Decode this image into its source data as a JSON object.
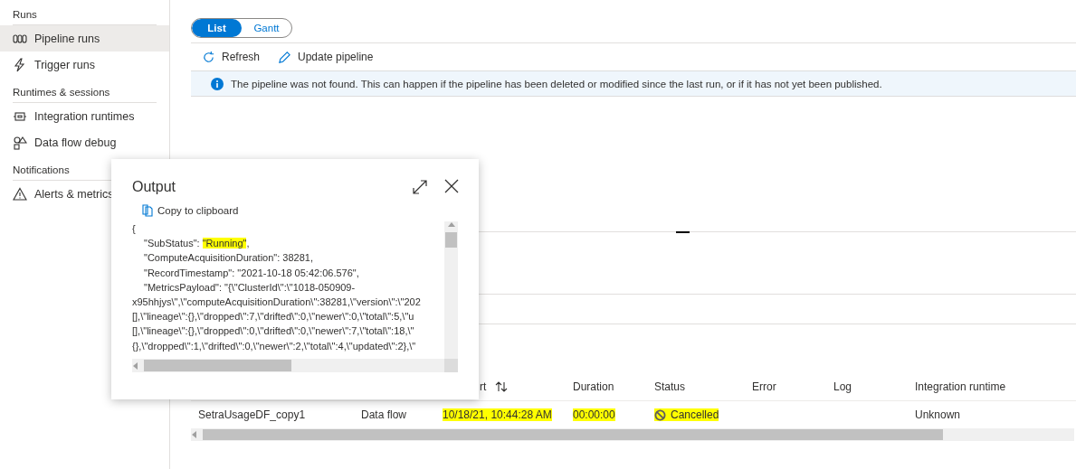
{
  "sidebar": {
    "sections": [
      {
        "heading": "Runs",
        "items": [
          {
            "label": "Pipeline runs",
            "kind": "pipeline",
            "selected": true
          },
          {
            "label": "Trigger runs",
            "kind": "trigger",
            "selected": false
          }
        ]
      },
      {
        "heading": "Runtimes & sessions",
        "items": [
          {
            "label": "Integration runtimes",
            "kind": "runtime",
            "selected": false
          },
          {
            "label": "Data flow debug",
            "kind": "debug",
            "selected": false
          }
        ]
      },
      {
        "heading": "Notifications",
        "items": [
          {
            "label": "Alerts & metrics",
            "kind": "alert",
            "selected": false
          }
        ]
      }
    ]
  },
  "view_toggle": [
    {
      "label": "List",
      "selected": true
    },
    {
      "label": "Gantt",
      "selected": false
    }
  ],
  "toolbar": [
    {
      "label": "Refresh",
      "kind": "refresh"
    },
    {
      "label": "Update pipeline",
      "kind": "edit"
    }
  ],
  "info_banner": "The pipeline was not found. This can happen if the pipeline has been deleted or modified since the last run, or if it has not yet been published.",
  "table": {
    "columns": [
      {
        "label": "rt",
        "sortable": true
      },
      {
        "label": "Duration",
        "sortable": false
      },
      {
        "label": "Status",
        "sortable": false
      },
      {
        "label": "Error",
        "sortable": false
      },
      {
        "label": "Log",
        "sortable": false
      },
      {
        "label": "Integration runtime",
        "sortable": false
      }
    ],
    "rows": [
      {
        "name": {
          "text": "SetraUsageDF_copy1",
          "highlighted": false
        },
        "type": {
          "text": "Data flow",
          "highlighted": false
        },
        "run_start": {
          "text": "10/18/21, 10:44:28 AM",
          "highlighted": true
        },
        "duration": {
          "text": "00:00:00",
          "highlighted": true
        },
        "status": {
          "text": "Cancelled",
          "highlighted": true
        },
        "integration_runtime": {
          "text": "Unknown",
          "highlighted": false
        }
      }
    ]
  },
  "output_dialog": {
    "title": "Output",
    "copy_label": "Copy to clipboard",
    "lines": [
      {
        "indent": false,
        "text": "{"
      },
      {
        "indent": true,
        "text": "\"SubStatus\": ",
        "highlight": "\"Running\"",
        "rest": ","
      },
      {
        "indent": true,
        "text": "\"ComputeAcquisitionDuration\": 38281,"
      },
      {
        "indent": true,
        "text": "\"RecordTimestamp\": \"2021-10-18 05:42:06.576\","
      },
      {
        "indent": true,
        "text": "\"MetricsPayload\": \"{\\\"ClusterId\\\":\\\"1018-050909-"
      },
      {
        "indent": false,
        "text": "x95hhjys\\\",\\\"computeAcquisitionDuration\\\":38281,\\\"version\\\":\\\"202"
      },
      {
        "indent": false,
        "text": "[],\\\"lineage\\\":{},\\\"dropped\\\":7,\\\"drifted\\\":0,\\\"newer\\\":0,\\\"total\\\":5,\\\"u"
      },
      {
        "indent": false,
        "text": "[],\\\"lineage\\\":{},\\\"dropped\\\":0,\\\"drifted\\\":0,\\\"newer\\\":7,\\\"total\\\":18,\\\""
      },
      {
        "indent": false,
        "text": "{},\\\"dropped\\\":1,\\\"drifted\\\":0,\\\"newer\\\":2,\\\"total\\\":4,\\\"updated\\\":2},\\\""
      }
    ]
  }
}
